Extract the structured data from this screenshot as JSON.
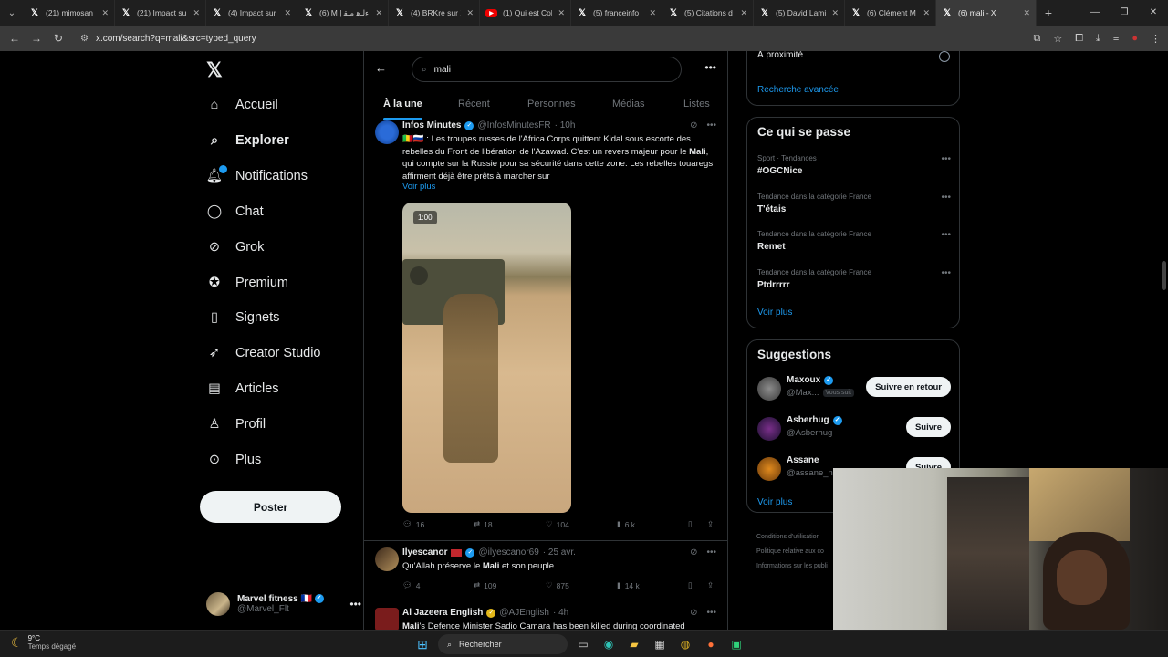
{
  "browser": {
    "tabs": [
      {
        "title": "(21) mimosan",
        "icon": "x-logo-icon"
      },
      {
        "title": "(21) Impact su",
        "icon": "x-logo-icon"
      },
      {
        "title": "(4) Impact sur",
        "icon": "x-logo-icon"
      },
      {
        "title": "(6) M | ﺀلـﻫ مـﻘ",
        "icon": "x-logo-icon"
      },
      {
        "title": "(4) BRKre sur X",
        "icon": "x-logo-icon"
      },
      {
        "title": "(1) Qui est Coli",
        "icon": "youtube-icon"
      },
      {
        "title": "(5) franceinfo",
        "icon": "x-logo-icon"
      },
      {
        "title": "(5) Citations d",
        "icon": "x-logo-icon"
      },
      {
        "title": "(5) David Lami",
        "icon": "x-logo-icon"
      },
      {
        "title": "(6) Clément M",
        "icon": "x-logo-icon"
      },
      {
        "title": "(6) mali - X",
        "icon": "x-logo-icon",
        "active": true
      }
    ],
    "url": "x.com/search?q=mali&src=typed_query"
  },
  "sidebar": {
    "items": [
      {
        "label": "Accueil",
        "icon": "home-icon"
      },
      {
        "label": "Explorer",
        "icon": "search-icon",
        "active": true
      },
      {
        "label": "Notifications",
        "icon": "bell-icon"
      },
      {
        "label": "Chat",
        "icon": "chat-icon"
      },
      {
        "label": "Grok",
        "icon": "grok-icon"
      },
      {
        "label": "Premium",
        "icon": "premium-icon"
      },
      {
        "label": "Signets",
        "icon": "bookmark-icon"
      },
      {
        "label": "Creator Studio",
        "icon": "rocket-icon"
      },
      {
        "label": "Articles",
        "icon": "article-icon"
      },
      {
        "label": "Profil",
        "icon": "profile-icon"
      },
      {
        "label": "Plus",
        "icon": "more-circle-icon"
      }
    ],
    "post_label": "Poster",
    "account": {
      "name": "Marvel fitness 🇫🇷",
      "handle": "@Marvel_Flt"
    }
  },
  "search": {
    "query": "mali"
  },
  "search_tabs": [
    "À la une",
    "Récent",
    "Personnes",
    "Médias",
    "Listes"
  ],
  "tweets": [
    {
      "name": "Infos Minutes",
      "handle": "@InfosMinutesFR",
      "time": "· 10h",
      "text_flags": "🇲🇱🇷🇺 : ",
      "text_1": "Les troupes russes de l'Africa Corps quittent Kidal sous escorte des rebelles du Front de libération de l'Azawad. C'est un revers majeur pour le ",
      "text_bold": "Mali",
      "text_2": ", qui compte sur la Russie pour sa sécurité dans cette zone. Les rebelles touaregs affirment déjà être prêts à marcher sur",
      "more": "Voir plus",
      "video_duration": "1:00",
      "replies": "16",
      "reposts": "18",
      "likes": "104",
      "views": "6 k"
    },
    {
      "name": "Ilyescanor",
      "handle": "@ilyescanor69",
      "time": "· 25 avr.",
      "text_1": "Qu'Allah préserve le ",
      "text_bold": "Mali",
      "text_2": " et son peuple",
      "replies": "4",
      "reposts": "109",
      "likes": "875",
      "views": "14 k"
    },
    {
      "name": "Al Jazeera English",
      "handle": "@AJEnglish",
      "time": "· 4h",
      "text_bold": "Mali",
      "text_2": "'s Defence Minister Sadio Camara has been killed during coordinated"
    }
  ],
  "right": {
    "nearby_label": "À proximité",
    "advanced_search": "Recherche avancée",
    "trends_title": "Ce qui se passe",
    "trends": [
      {
        "category": "Sport · Tendances",
        "name": "#OGCNice"
      },
      {
        "category": "Tendance dans la catégorie France",
        "name": "T'étais"
      },
      {
        "category": "Tendance dans la catégorie France",
        "name": "Remet"
      },
      {
        "category": "Tendance dans la catégorie France",
        "name": "Ptdrrrrr"
      }
    ],
    "trends_more": "Voir plus",
    "suggestions_title": "Suggestions",
    "suggestions": [
      {
        "name": "Maxoux",
        "handle": "@Max...",
        "follows_you": "Vous suit",
        "button": "Suivre en retour"
      },
      {
        "name": "Asberhug",
        "handle": "@Asberhug",
        "button": "Suivre"
      },
      {
        "name": "Assane",
        "handle": "@assane_n",
        "button": "Suivre"
      }
    ],
    "suggestions_more": "Voir plus",
    "footer": [
      "Conditions d'utilisation",
      "Politique relative aux co",
      "Informations sur les publi"
    ]
  },
  "taskbar": {
    "temp": "9°C",
    "weather": "Temps dégagé",
    "search_label": "Rechercher"
  },
  "colors": {
    "accent": "#1d9bf0",
    "background": "#000000",
    "border": "#2f3336",
    "muted": "#71767b"
  }
}
